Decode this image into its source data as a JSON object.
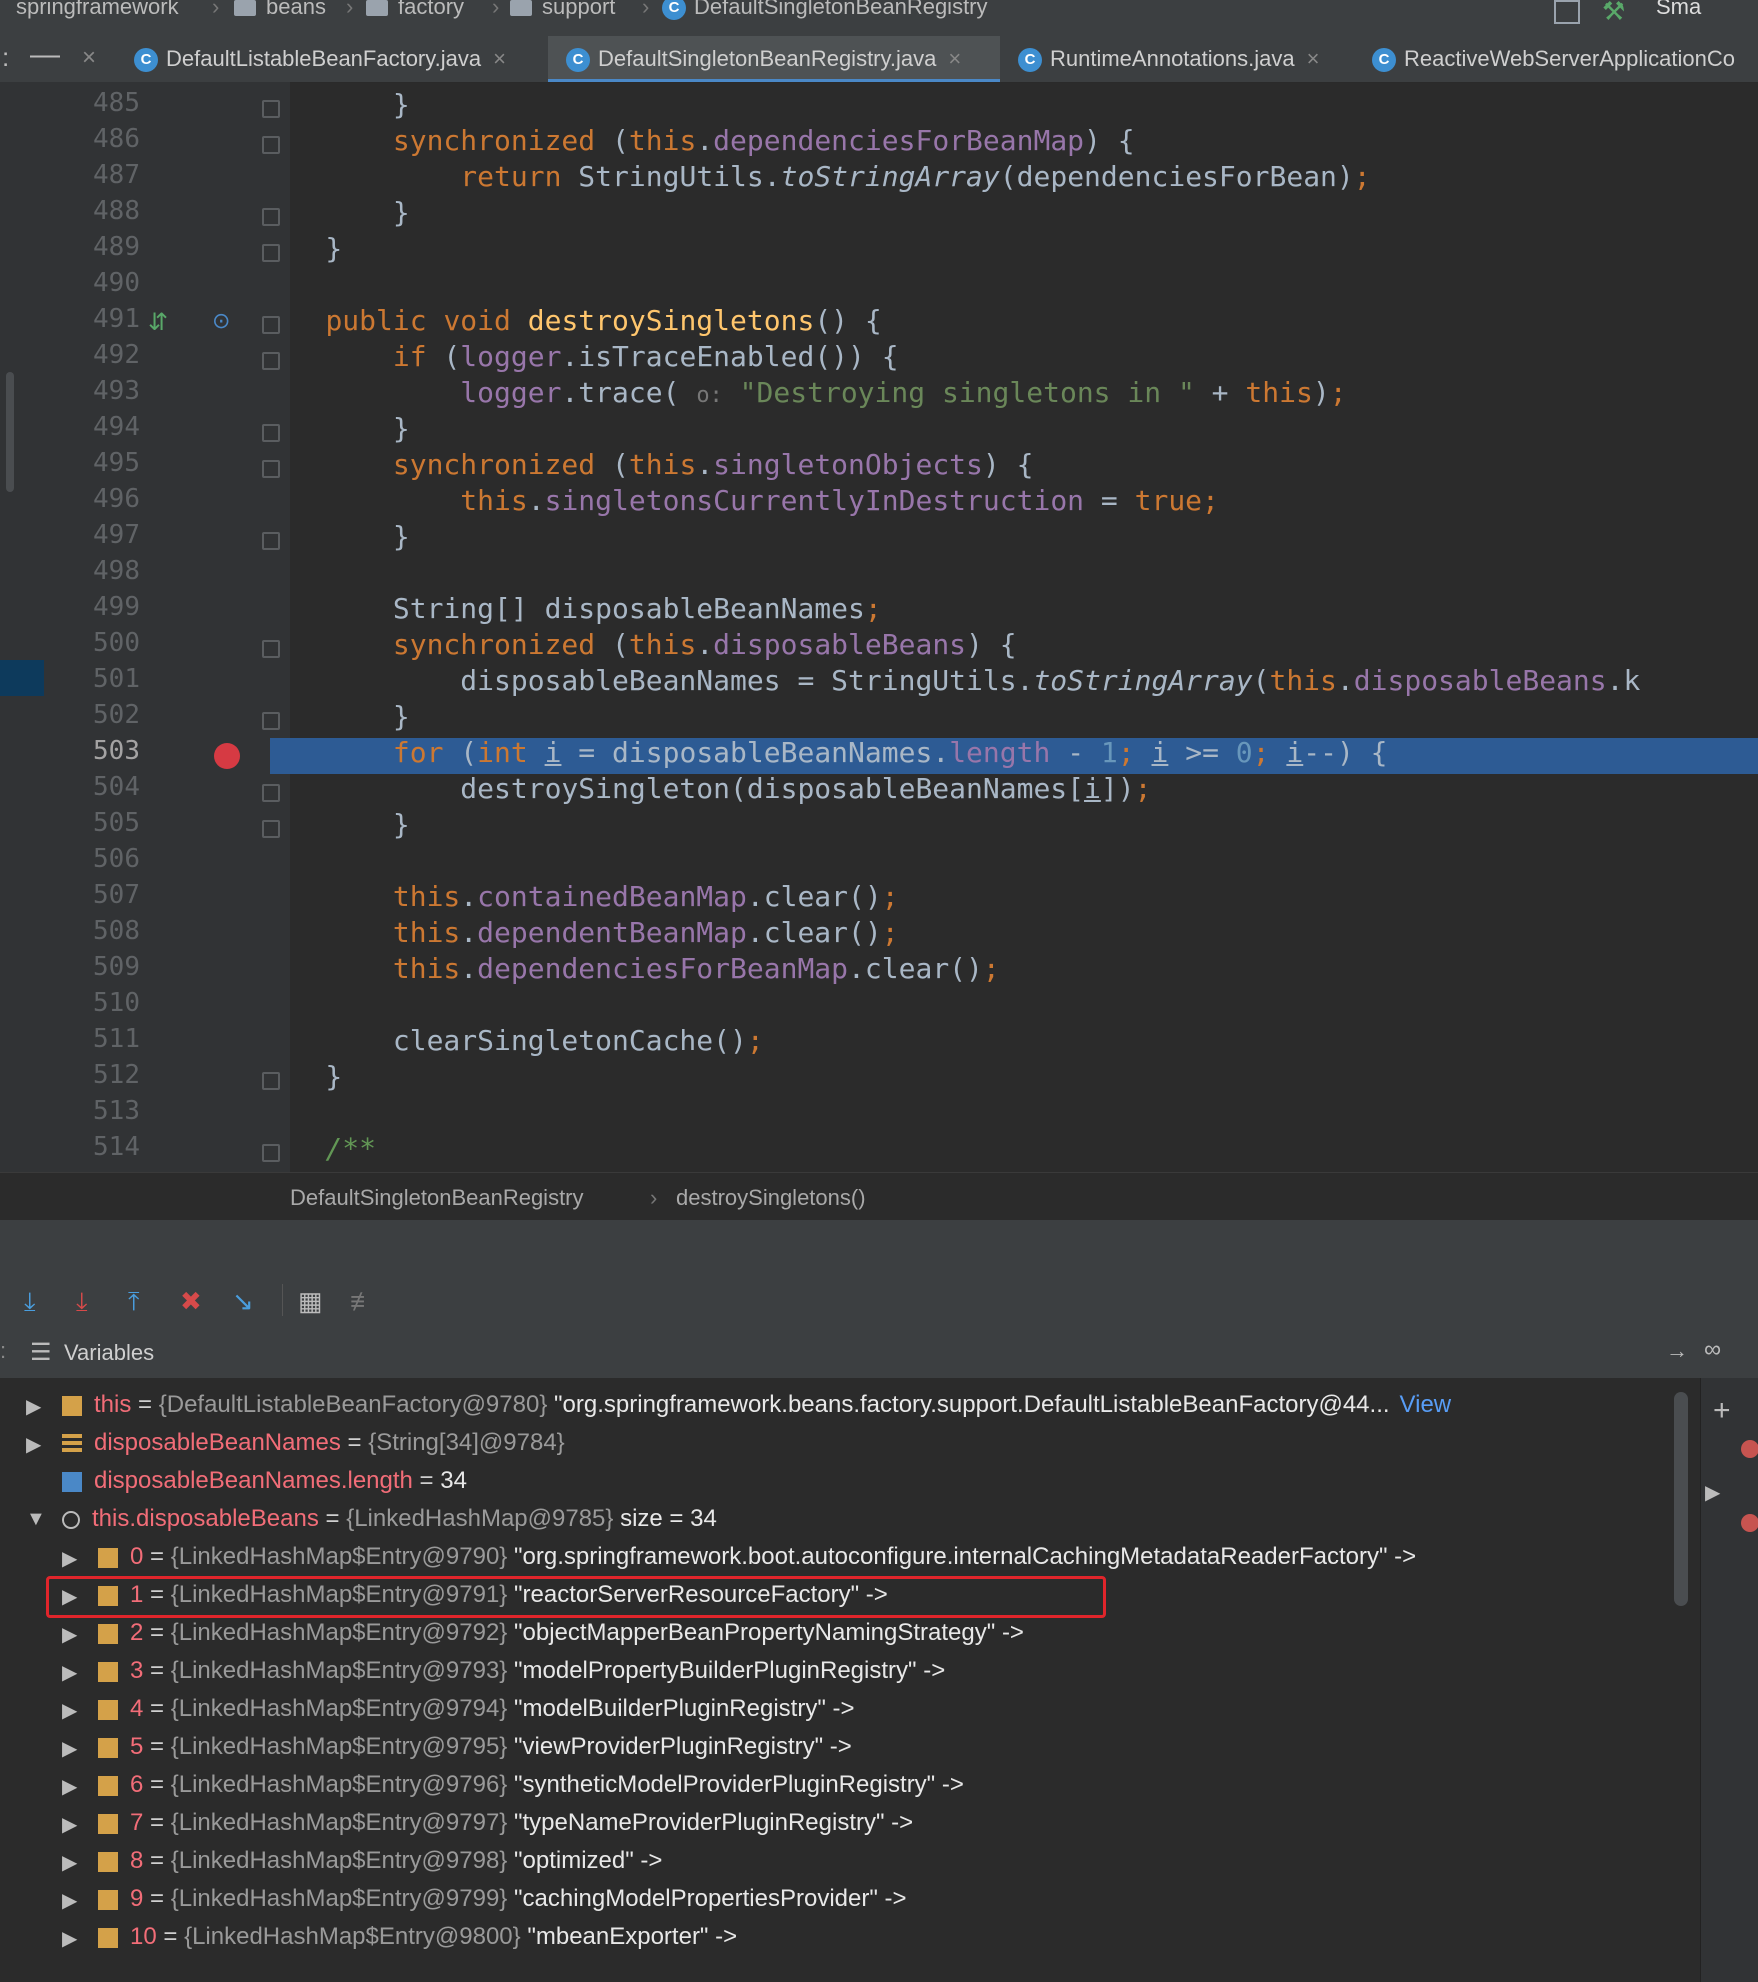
{
  "breadcrumb": {
    "items": [
      "springframework",
      "beans",
      "factory",
      "support",
      "DefaultSingletonBeanRegistry"
    ],
    "right_label": "Sma"
  },
  "tabs": [
    {
      "label": "DefaultListableBeanFactory.java",
      "active": false
    },
    {
      "label": "DefaultSingletonBeanRegistry.java",
      "active": true
    },
    {
      "label": "RuntimeAnnotations.java",
      "active": false
    },
    {
      "label": "ReactiveWebServerApplicationCo",
      "active": false
    }
  ],
  "tab_close": "×",
  "editor": {
    "lines": [
      {
        "n": "485",
        "html": "        }"
      },
      {
        "n": "486",
        "html": "        <span class=\"kw\">synchronized</span> (<span class=\"kw\">this</span>.<span class=\"fld\">dependenciesForBeanMap</span>) {"
      },
      {
        "n": "487",
        "html": "            <span class=\"kw\">return</span> StringUtils.<span class=\"it\">toStringArray</span>(dependenciesForBean)<span class=\"kw\">;</span>"
      },
      {
        "n": "488",
        "html": "        }"
      },
      {
        "n": "489",
        "html": "    }"
      },
      {
        "n": "490",
        "html": ""
      },
      {
        "n": "491",
        "html": "    <span class=\"kw\">public void</span> <span class=\"fn\">destroySingletons</span>() {"
      },
      {
        "n": "492",
        "html": "        <span class=\"kw\">if</span> (<span class=\"fld\">logger</span>.isTraceEnabled()) {"
      },
      {
        "n": "493",
        "html": "            <span class=\"fld\">logger</span>.trace( <span style=\"color:#777;font-size:22px\">o:</span> <span class=\"str\">\"Destroying singletons in \"</span> + <span class=\"kw\">this</span>)<span class=\"kw\">;</span>"
      },
      {
        "n": "494",
        "html": "        }"
      },
      {
        "n": "495",
        "html": "        <span class=\"kw\">synchronized</span> (<span class=\"kw\">this</span>.<span class=\"fld\">singletonObjects</span>) {"
      },
      {
        "n": "496",
        "html": "            <span class=\"kw\">this</span>.<span class=\"fld\">singletonsCurrentlyInDestruction</span> = <span class=\"kw\">true;</span>"
      },
      {
        "n": "497",
        "html": "        }"
      },
      {
        "n": "498",
        "html": ""
      },
      {
        "n": "499",
        "html": "        String[] disposableBeanNames<span class=\"kw\">;</span>"
      },
      {
        "n": "500",
        "html": "        <span class=\"kw\">synchronized</span> (<span class=\"kw\">this</span>.<span class=\"fld\">disposableBeans</span>) {"
      },
      {
        "n": "501",
        "html": "            disposableBeanNames = StringUtils.<span class=\"it\">toStringArray</span>(<span class=\"kw\">this</span>.<span class=\"fld\">disposableBeans</span>.k"
      },
      {
        "n": "502",
        "html": "        }"
      },
      {
        "n": "503",
        "html": "        <span class=\"kw\">for</span> (<span class=\"kw\">int</span> <u>i</u> = disposableBeanNames.<span class=\"fld\">length</span> - <span class=\"num\">1</span><span class=\"kw\">;</span> <u>i</u> &gt;= <span class=\"num\">0</span><span class=\"kw\">;</span> <u>i</u>--) {"
      },
      {
        "n": "504",
        "html": "            destroySingleton(disposableBeanNames[<u>i</u>])<span class=\"kw\">;</span>"
      },
      {
        "n": "505",
        "html": "        }"
      },
      {
        "n": "506",
        "html": ""
      },
      {
        "n": "507",
        "html": "        <span class=\"kw\">this</span>.<span class=\"fld\">containedBeanMap</span>.clear()<span class=\"kw\">;</span>"
      },
      {
        "n": "508",
        "html": "        <span class=\"kw\">this</span>.<span class=\"fld\">dependentBeanMap</span>.clear()<span class=\"kw\">;</span>"
      },
      {
        "n": "509",
        "html": "        <span class=\"kw\">this</span>.<span class=\"fld\">dependenciesForBeanMap</span>.clear()<span class=\"kw\">;</span>"
      },
      {
        "n": "510",
        "html": ""
      },
      {
        "n": "511",
        "html": "        clearSingletonCache()<span class=\"kw\">;</span>"
      },
      {
        "n": "512",
        "html": "    }"
      },
      {
        "n": "513",
        "html": ""
      },
      {
        "n": "514",
        "html": "    <span class=\"cm\">/**</span>"
      }
    ],
    "current_line": "503"
  },
  "editor_breadcrumb": {
    "class": "DefaultSingletonBeanRegistry",
    "method": "destroySingletons()"
  },
  "variables": {
    "title": "Variables",
    "view_link": "View",
    "rows": [
      {
        "name": "this",
        "ref": "{DefaultListableBeanFactory@9780}",
        "value": "\"org.springframework.beans.factory.support.DefaultListableBeanFactory@44...",
        "indent": 0,
        "arrow": "▶"
      },
      {
        "name": "disposableBeanNames",
        "ref": "{String[34]@9784}",
        "value": "",
        "indent": 0,
        "arrow": "▶"
      },
      {
        "name": "disposableBeanNames.length",
        "ref": "",
        "value": "34",
        "indent": 0,
        "arrow": ""
      },
      {
        "name": "this.disposableBeans",
        "ref": "{LinkedHashMap@9785}",
        "value": " size = 34",
        "indent": 0,
        "arrow": "▼"
      },
      {
        "name": "0",
        "ref": "{LinkedHashMap$Entry@9790}",
        "value": "\"org.springframework.boot.autoconfigure.internalCachingMetadataReaderFactory\" ->",
        "indent": 1,
        "arrow": "▶"
      },
      {
        "name": "1",
        "ref": "{LinkedHashMap$Entry@9791}",
        "value": "\"reactorServerResourceFactory\" ->",
        "indent": 1,
        "arrow": "▶"
      },
      {
        "name": "2",
        "ref": "{LinkedHashMap$Entry@9792}",
        "value": "\"objectMapperBeanPropertyNamingStrategy\" ->",
        "indent": 1,
        "arrow": "▶"
      },
      {
        "name": "3",
        "ref": "{LinkedHashMap$Entry@9793}",
        "value": "\"modelPropertyBuilderPluginRegistry\" ->",
        "indent": 1,
        "arrow": "▶"
      },
      {
        "name": "4",
        "ref": "{LinkedHashMap$Entry@9794}",
        "value": "\"modelBuilderPluginRegistry\" ->",
        "indent": 1,
        "arrow": "▶"
      },
      {
        "name": "5",
        "ref": "{LinkedHashMap$Entry@9795}",
        "value": "\"viewProviderPluginRegistry\" ->",
        "indent": 1,
        "arrow": "▶"
      },
      {
        "name": "6",
        "ref": "{LinkedHashMap$Entry@9796}",
        "value": "\"syntheticModelProviderPluginRegistry\" ->",
        "indent": 1,
        "arrow": "▶"
      },
      {
        "name": "7",
        "ref": "{LinkedHashMap$Entry@9797}",
        "value": "\"typeNameProviderPluginRegistry\" ->",
        "indent": 1,
        "arrow": "▶"
      },
      {
        "name": "8",
        "ref": "{LinkedHashMap$Entry@9798}",
        "value": "\"optimized\" ->",
        "indent": 1,
        "arrow": "▶"
      },
      {
        "name": "9",
        "ref": "{LinkedHashMap$Entry@9799}",
        "value": "\"cachingModelPropertiesProvider\" ->",
        "indent": 1,
        "arrow": "▶"
      },
      {
        "name": "10",
        "ref": "{LinkedHashMap$Entry@9800}",
        "value": "\"mbeanExporter\" ->",
        "indent": 1,
        "arrow": "▶"
      }
    ]
  },
  "colors": {
    "highlight_line": "#2d5b94",
    "selection_box": "#e0252b"
  }
}
